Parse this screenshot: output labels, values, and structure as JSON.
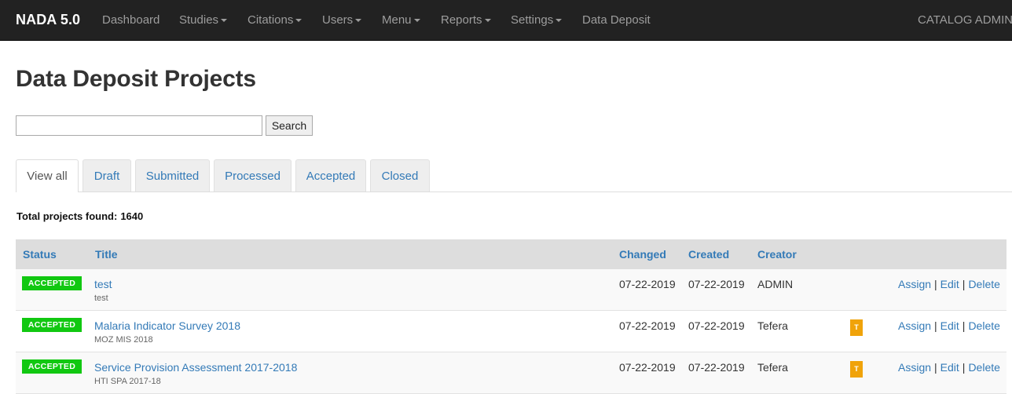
{
  "navbar": {
    "brand": "NADA 5.0",
    "items": [
      {
        "label": "Dashboard",
        "dropdown": false
      },
      {
        "label": "Studies",
        "dropdown": true
      },
      {
        "label": "Citations",
        "dropdown": true
      },
      {
        "label": "Users",
        "dropdown": true
      },
      {
        "label": "Menu",
        "dropdown": true
      },
      {
        "label": "Reports",
        "dropdown": true
      },
      {
        "label": "Settings",
        "dropdown": true
      },
      {
        "label": "Data Deposit",
        "dropdown": false
      }
    ],
    "right_label": "CATALOG ADMIN"
  },
  "page": {
    "title": "Data Deposit Projects"
  },
  "search": {
    "value": "",
    "button_label": "Search"
  },
  "tabs": [
    {
      "label": "View all",
      "active": true
    },
    {
      "label": "Draft",
      "active": false
    },
    {
      "label": "Submitted",
      "active": false
    },
    {
      "label": "Processed",
      "active": false
    },
    {
      "label": "Accepted",
      "active": false
    },
    {
      "label": "Closed",
      "active": false
    }
  ],
  "summary": {
    "label": "Total projects found:",
    "count": "1640"
  },
  "table": {
    "headers": {
      "status": "Status",
      "title": "Title",
      "changed": "Changed",
      "created": "Created",
      "creator": "Creator"
    },
    "rows": [
      {
        "status": "ACCEPTED",
        "title": "test",
        "subtitle": "test",
        "changed": "07-22-2019",
        "created": "07-22-2019",
        "creator": "ADMIN",
        "icon": ""
      },
      {
        "status": "ACCEPTED",
        "title": "Malaria Indicator Survey 2018",
        "subtitle": "MOZ MIS 2018",
        "changed": "07-22-2019",
        "created": "07-22-2019",
        "creator": "Tefera",
        "icon": "T"
      },
      {
        "status": "ACCEPTED",
        "title": "Service Provision Assessment 2017-2018",
        "subtitle": "HTI SPA 2017-18",
        "changed": "07-22-2019",
        "created": "07-22-2019",
        "creator": "Tefera",
        "icon": "T"
      }
    ],
    "actions": {
      "assign": "Assign",
      "edit": "Edit",
      "delete": "Delete",
      "separator": "|"
    }
  },
  "colors": {
    "navbar_bg": "#222222",
    "link": "#337ab7",
    "status_accepted": "#11c811",
    "user_icon": "#f0a30a",
    "table_header_bg": "#dddddd"
  }
}
